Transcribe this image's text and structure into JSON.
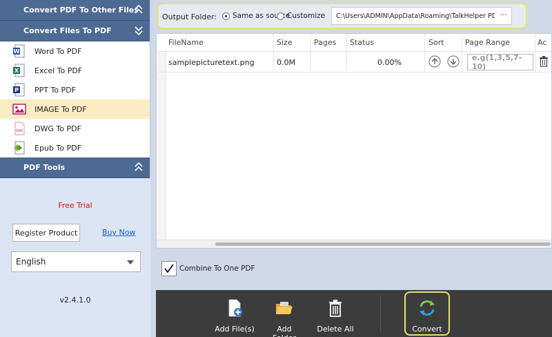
{
  "sidebar": {
    "section1_title": "Convert PDF To Other Files",
    "section2_title": "Convert Files To PDF",
    "items": [
      {
        "label": "Word To PDF",
        "icon": "word-icon",
        "active": false
      },
      {
        "label": "Excel To PDF",
        "icon": "excel-icon",
        "active": false
      },
      {
        "label": "PPT To PDF",
        "icon": "ppt-icon",
        "active": false
      },
      {
        "label": "IMAGE To PDF",
        "icon": "image-icon",
        "active": true
      },
      {
        "label": "DWG To PDF",
        "icon": "dwg-icon",
        "active": false
      },
      {
        "label": "Epub To PDF",
        "icon": "epub-icon",
        "active": false
      }
    ],
    "section3_title": "PDF Tools",
    "free_trial": "Free Trial",
    "register_label": "Register Product",
    "buy_now_label": "Buy Now",
    "language": "English",
    "version": "v2.4.1.0"
  },
  "output": {
    "label": "Output Folder:",
    "option_same": "Same as source",
    "option_custom": "Customize",
    "selected": "Same as source",
    "path": "C:\\Users\\ADMIN\\AppData\\Roaming\\TalkHelper PDF C",
    "more_label": "···"
  },
  "table": {
    "headers": [
      "FileName",
      "Size",
      "Pages",
      "Status",
      "Sort",
      "Page Range",
      "Ac"
    ],
    "rows": [
      {
        "filename": "samplepicturetext.png",
        "size": "0.0M",
        "pages": "",
        "status": "0.00%",
        "range_placeholder": "e.g(1,3,5,7-10)"
      }
    ]
  },
  "combine": {
    "label": "Combine To One PDF",
    "checked": true
  },
  "toolbar": {
    "add_files": "Add File(s)",
    "add_folder": "Add Folder",
    "delete_all": "Delete All",
    "convert": "Convert"
  },
  "colors": {
    "header_blue": "#4d6a93",
    "highlight_yellow": "#e6e36a",
    "active_item": "#fbecc4",
    "toolbar_dark": "#3c3c3c",
    "free_trial_red": "#e01010"
  }
}
